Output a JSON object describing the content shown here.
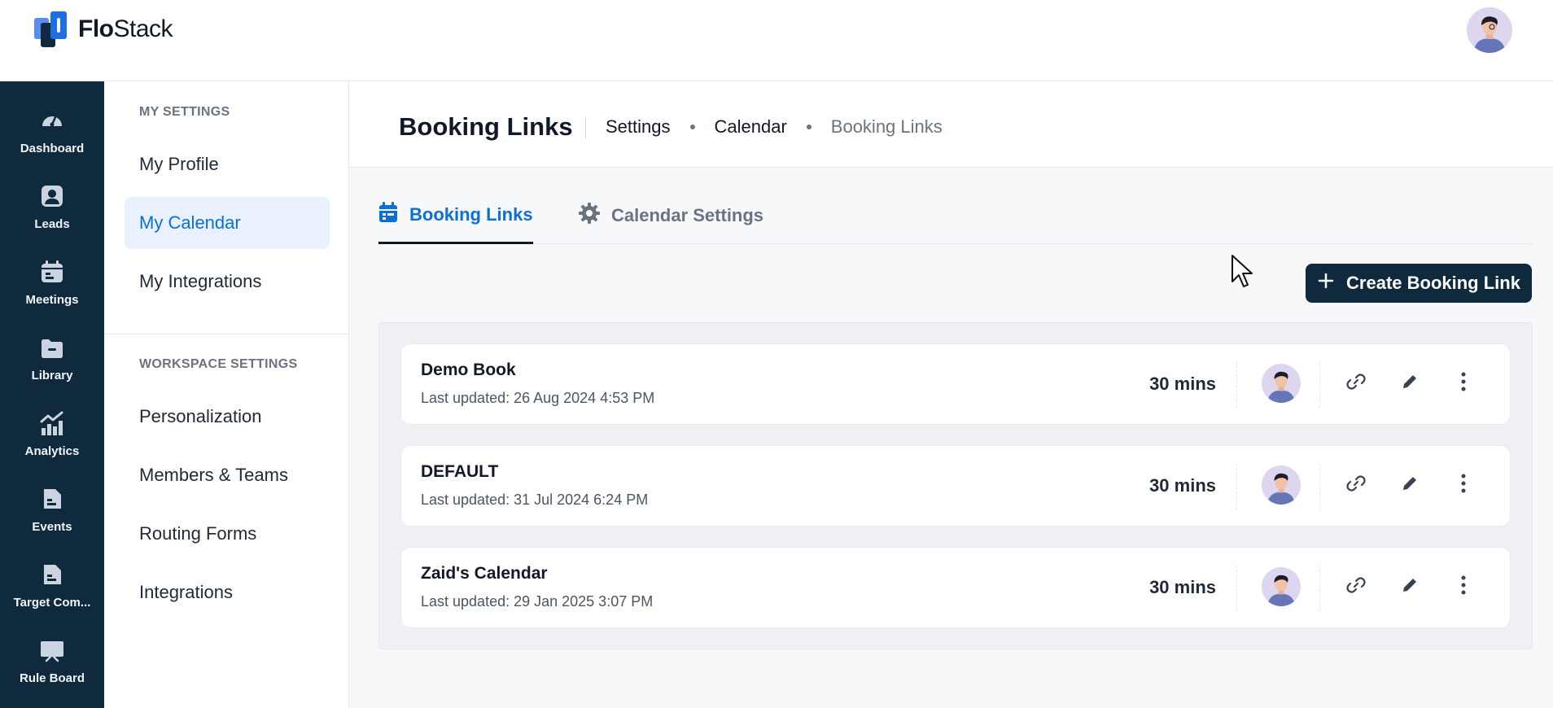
{
  "app": {
    "name_bold": "Flo",
    "name_rest": "Stack"
  },
  "rail": [
    {
      "label": "Dashboard",
      "icon": "gauge-icon"
    },
    {
      "label": "Leads",
      "icon": "user-icon"
    },
    {
      "label": "Meetings",
      "icon": "calendar-icon"
    },
    {
      "label": "Library",
      "icon": "folder-icon"
    },
    {
      "label": "Analytics",
      "icon": "chart-icon"
    },
    {
      "label": "Events",
      "icon": "document-icon"
    },
    {
      "label": "Target Com...",
      "icon": "file-icon"
    },
    {
      "label": "Rule Board",
      "icon": "board-icon"
    }
  ],
  "settings": {
    "my_title": "MY SETTINGS",
    "my_items": [
      "My Profile",
      "My Calendar",
      "My Integrations"
    ],
    "active_item": "My Calendar",
    "ws_title": "WORKSPACE SETTINGS",
    "ws_items": [
      "Personalization",
      "Members & Teams",
      "Routing Forms",
      "Integrations"
    ]
  },
  "page": {
    "title": "Booking Links",
    "breadcrumb": [
      "Settings",
      "Calendar",
      "Booking Links"
    ]
  },
  "tabs": [
    {
      "label": "Booking Links",
      "icon": "calendar-icon",
      "active": true
    },
    {
      "label": "Calendar Settings",
      "icon": "gear-icon",
      "active": false
    }
  ],
  "create_button": {
    "label": "Create Booking Link"
  },
  "booking_links": [
    {
      "name": "Demo Book",
      "updated": "Last updated: 26 Aug 2024 4:53 PM",
      "duration": "30 mins"
    },
    {
      "name": "DEFAULT",
      "updated": "Last updated: 31 Jul 2024 6:24 PM",
      "duration": "30 mins"
    },
    {
      "name": "Zaid's Calendar",
      "updated": "Last updated: 29 Jan 2025 3:07 PM",
      "duration": "30 mins"
    }
  ],
  "colors": {
    "rail_bg": "#0f2a3d",
    "accent": "#0b6fd6",
    "active_bg": "#e8f1fd"
  }
}
